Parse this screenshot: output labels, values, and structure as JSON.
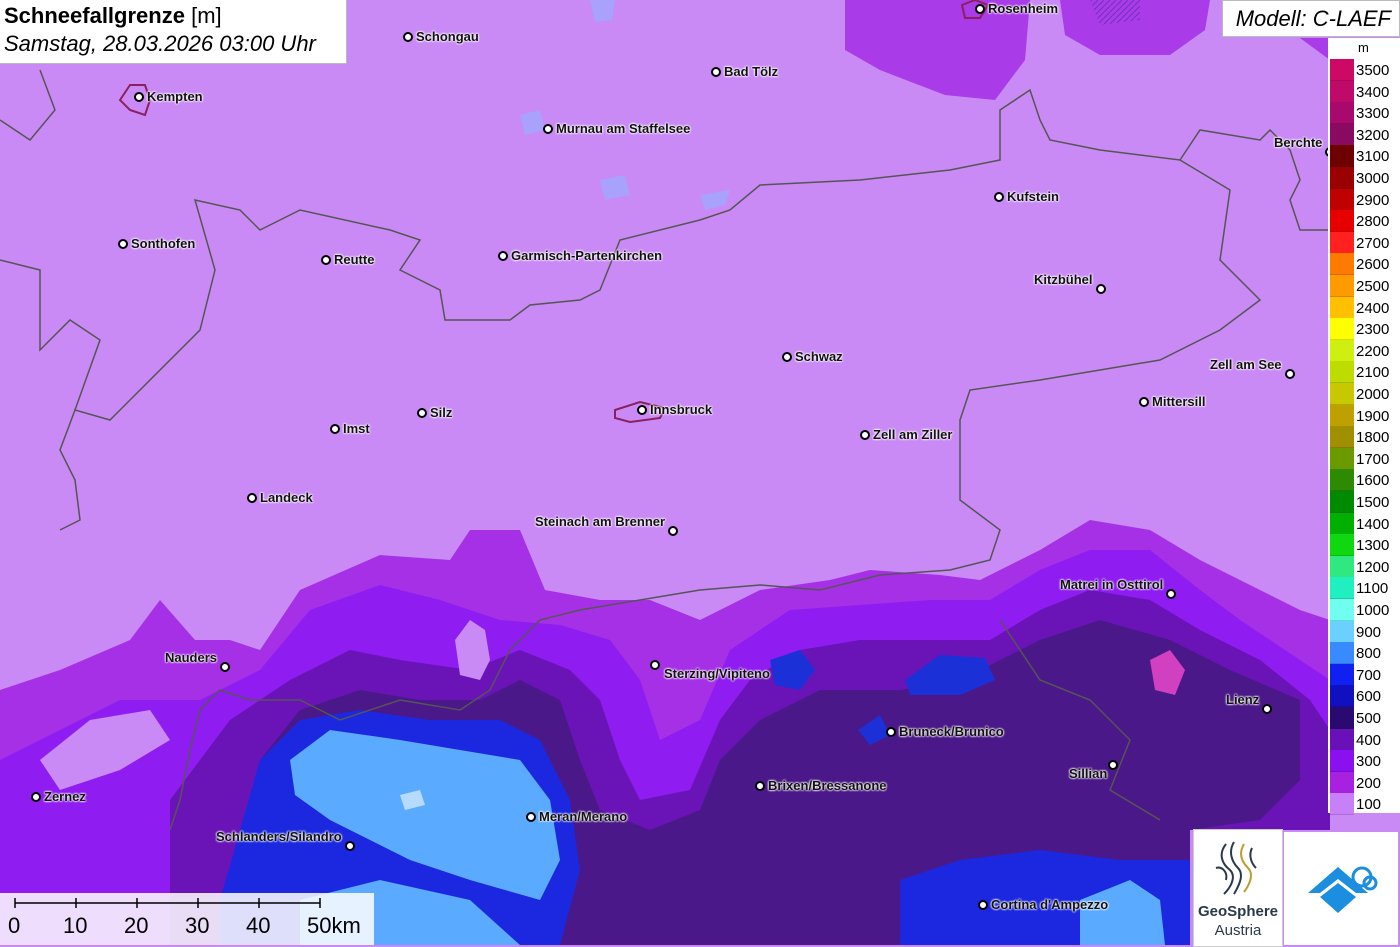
{
  "title": {
    "main": "Schneefallgrenze",
    "unit": "[m]",
    "date": "Samstag, 28.03.2026 03:00 Uhr"
  },
  "model": "Modell: C-LAEF",
  "legend": {
    "unit": "m",
    "entries": [
      {
        "label": "3500",
        "color": "#cc0a66"
      },
      {
        "label": "3400",
        "color": "#c00a6a"
      },
      {
        "label": "3300",
        "color": "#a8096c"
      },
      {
        "label": "3200",
        "color": "#8a0a62"
      },
      {
        "label": "3100",
        "color": "#6e0000"
      },
      {
        "label": "3000",
        "color": "#9a0000"
      },
      {
        "label": "2900",
        "color": "#c00000"
      },
      {
        "label": "2800",
        "color": "#e60000"
      },
      {
        "label": "2700",
        "color": "#ff2020"
      },
      {
        "label": "2600",
        "color": "#ff7a00"
      },
      {
        "label": "2500",
        "color": "#ff9a00"
      },
      {
        "label": "2400",
        "color": "#ffc000"
      },
      {
        "label": "2300",
        "color": "#ffff00"
      },
      {
        "label": "2200",
        "color": "#cfef10"
      },
      {
        "label": "2100",
        "color": "#bfdc00"
      },
      {
        "label": "2000",
        "color": "#c8c800"
      },
      {
        "label": "1900",
        "color": "#bea000"
      },
      {
        "label": "1800",
        "color": "#a09000"
      },
      {
        "label": "1700",
        "color": "#6a9a00"
      },
      {
        "label": "1600",
        "color": "#2e8a00"
      },
      {
        "label": "1500",
        "color": "#008a00"
      },
      {
        "label": "1400",
        "color": "#00b000"
      },
      {
        "label": "1300",
        "color": "#10d810"
      },
      {
        "label": "1200",
        "color": "#30e880"
      },
      {
        "label": "1100",
        "color": "#20f0c0"
      },
      {
        "label": "1000",
        "color": "#70ffee"
      },
      {
        "label": "900",
        "color": "#6ad0ff"
      },
      {
        "label": "800",
        "color": "#3a8aff"
      },
      {
        "label": "700",
        "color": "#1020f0"
      },
      {
        "label": "600",
        "color": "#1010c0"
      },
      {
        "label": "500",
        "color": "#2a0a70"
      },
      {
        "label": "400",
        "color": "#6a10b8"
      },
      {
        "label": "300",
        "color": "#8a10f0"
      },
      {
        "label": "200",
        "color": "#a820e0"
      },
      {
        "label": "100",
        "color": "#c880f8"
      }
    ]
  },
  "cities": [
    {
      "name": "Rosenheim"
    },
    {
      "name": "Schongau"
    },
    {
      "name": "Kempten"
    },
    {
      "name": "Bad Tölz"
    },
    {
      "name": "Murnau am Staffelsee"
    },
    {
      "name": "Berchte"
    },
    {
      "name": "Kufstein"
    },
    {
      "name": "Sonthofen"
    },
    {
      "name": "Reutte"
    },
    {
      "name": "Garmisch-Partenkirchen"
    },
    {
      "name": "Kitzbühel"
    },
    {
      "name": "Schwaz"
    },
    {
      "name": "Zell am See"
    },
    {
      "name": "Mittersill"
    },
    {
      "name": "Silz"
    },
    {
      "name": "Innsbruck"
    },
    {
      "name": "Imst"
    },
    {
      "name": "Zell am Ziller"
    },
    {
      "name": "Landeck"
    },
    {
      "name": "Steinach am Brenner"
    },
    {
      "name": "Matrei in Osttirol"
    },
    {
      "name": "Nauders"
    },
    {
      "name": "Sterzing/Vipiteno"
    },
    {
      "name": "Lienz"
    },
    {
      "name": "Bruneck/Brunico"
    },
    {
      "name": "Sillian"
    },
    {
      "name": "Brixen/Bressanone"
    },
    {
      "name": "Zernez"
    },
    {
      "name": "Meran/Merano"
    },
    {
      "name": "Schlanders/Silandro"
    },
    {
      "name": "Cortina d'Ampezzo"
    }
  ],
  "scale": {
    "labels": [
      "0",
      "10",
      "20",
      "30",
      "40",
      "50km"
    ]
  },
  "logo": {
    "line1": "GeoSphere",
    "line2": "Austria"
  }
}
